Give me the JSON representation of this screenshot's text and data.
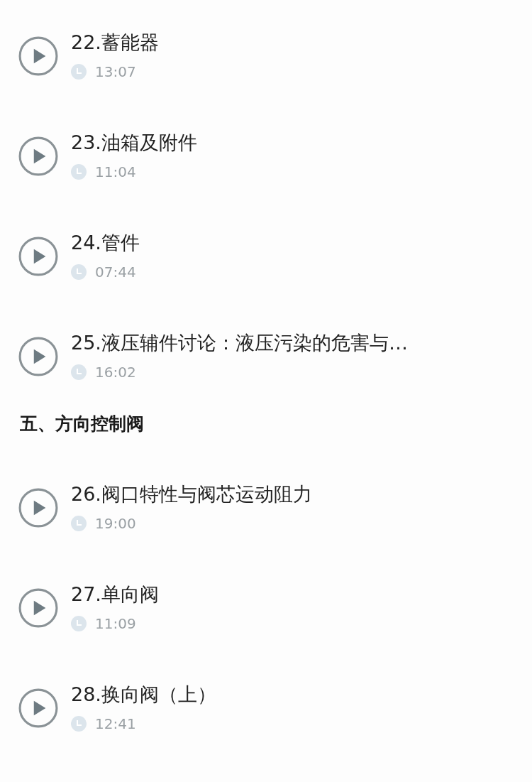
{
  "entries": [
    {
      "kind": "lesson",
      "title": "22.蓄能器",
      "duration": "13:07"
    },
    {
      "kind": "lesson",
      "title": "23.油箱及附件",
      "duration": "11:04"
    },
    {
      "kind": "lesson",
      "title": "24.管件",
      "duration": "07:44"
    },
    {
      "kind": "lesson",
      "title": "25.液压辅件讨论：液压污染的危害与…",
      "duration": "16:02"
    },
    {
      "kind": "section",
      "title": "五、方向控制阀"
    },
    {
      "kind": "lesson",
      "title": "26.阀口特性与阀芯运动阻力",
      "duration": "19:00"
    },
    {
      "kind": "lesson",
      "title": "27.单向阀",
      "duration": "11:09"
    },
    {
      "kind": "lesson",
      "title": "28.换向阀（上）",
      "duration": "12:41"
    }
  ]
}
